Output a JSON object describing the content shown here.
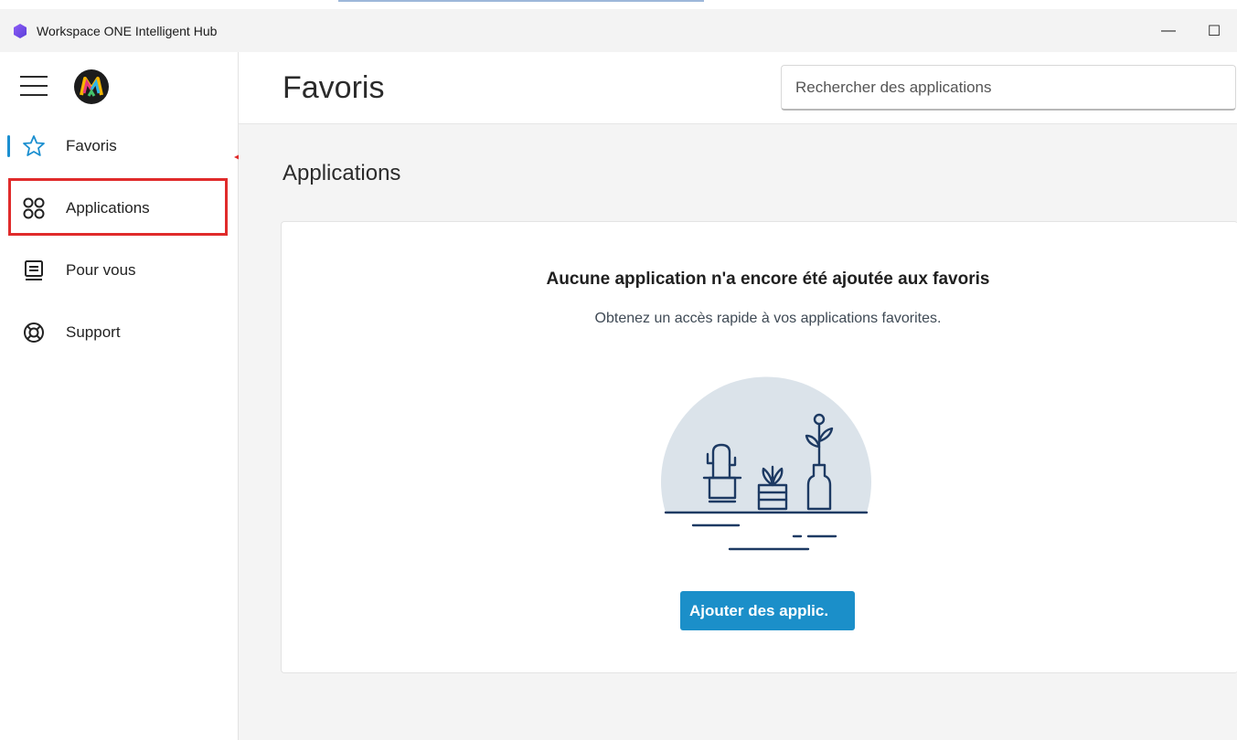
{
  "window": {
    "title": "Workspace ONE Intelligent Hub",
    "controls": {
      "minimize": "—",
      "maximize": "☐"
    }
  },
  "sidebar": {
    "items": [
      {
        "label": "Favoris",
        "icon": "star-icon",
        "active": true
      },
      {
        "label": "Applications",
        "icon": "apps-grid-icon",
        "active": false
      },
      {
        "label": "Pour vous",
        "icon": "for-you-icon",
        "active": false
      },
      {
        "label": "Support",
        "icon": "lifebuoy-icon",
        "active": false
      }
    ]
  },
  "header": {
    "title": "Favoris",
    "search_placeholder": "Rechercher des applications"
  },
  "main": {
    "section_title": "Applications",
    "empty_state": {
      "title": "Aucune application n'a encore été ajoutée aux favoris",
      "subtitle": "Obtenez un accès rapide à vos applications favorites.",
      "button_label": "Ajouter des applic."
    }
  },
  "colors": {
    "accent": "#1b8fc9",
    "highlight": "#e02b2b",
    "illustration_bg": "#dbe3ea",
    "illustration_line": "#1d3a63"
  }
}
